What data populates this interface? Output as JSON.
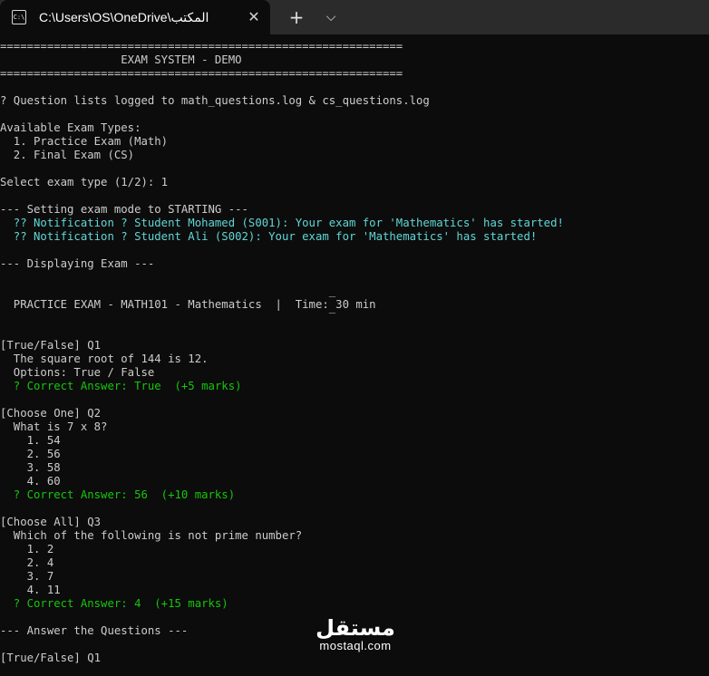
{
  "window": {
    "tab_icon_text": "C:\\",
    "tab_title": "C:\\Users\\OS\\OneDrive\\المكتب",
    "close_glyph": "✕",
    "new_tab_glyph": "+",
    "dropdown_glyph": "⌵"
  },
  "terminal": {
    "lines": [
      {
        "text": "============================================================",
        "color": "default"
      },
      {
        "text": "                  EXAM SYSTEM - DEMO",
        "color": "default"
      },
      {
        "text": "============================================================",
        "color": "default"
      },
      {
        "text": "",
        "color": "default"
      },
      {
        "text": "? Question lists logged to math_questions.log & cs_questions.log",
        "color": "default"
      },
      {
        "text": "",
        "color": "default"
      },
      {
        "text": "Available Exam Types:",
        "color": "default"
      },
      {
        "text": "  1. Practice Exam (Math)",
        "color": "default"
      },
      {
        "text": "  2. Final Exam (CS)",
        "color": "default"
      },
      {
        "text": "",
        "color": "default"
      },
      {
        "text": "Select exam type (1/2): 1",
        "color": "default"
      },
      {
        "text": "",
        "color": "default"
      },
      {
        "text": "--- Setting exam mode to STARTING ---",
        "color": "default"
      },
      {
        "text": "  ?? Notification ? Student Mohamed (S001): Your exam for 'Mathematics' has started!",
        "color": "cyan"
      },
      {
        "text": "  ?? Notification ? Student Ali (S002): Your exam for 'Mathematics' has started!",
        "color": "cyan"
      },
      {
        "text": "",
        "color": "default"
      },
      {
        "text": "--- Displaying Exam ---",
        "color": "default"
      },
      {
        "text": "",
        "color": "default"
      },
      {
        "text": "                                                 _",
        "color": "default"
      },
      {
        "text": "  PRACTICE EXAM - MATH101 - Mathematics  |  Time: 30 min",
        "color": "default"
      },
      {
        "text": "                                                 ‾",
        "color": "default"
      },
      {
        "text": "",
        "color": "default"
      },
      {
        "text": "[True/False] Q1",
        "color": "default"
      },
      {
        "text": "  The square root of 144 is 12.",
        "color": "default"
      },
      {
        "text": "  Options: True / False",
        "color": "default"
      },
      {
        "text": "  ? Correct Answer: True  (+5 marks)",
        "color": "green"
      },
      {
        "text": "",
        "color": "default"
      },
      {
        "text": "[Choose One] Q2",
        "color": "default"
      },
      {
        "text": "  What is 7 x 8?",
        "color": "default"
      },
      {
        "text": "    1. 54",
        "color": "default"
      },
      {
        "text": "    2. 56",
        "color": "default"
      },
      {
        "text": "    3. 58",
        "color": "default"
      },
      {
        "text": "    4. 60",
        "color": "default"
      },
      {
        "text": "  ? Correct Answer: 56  (+10 marks)",
        "color": "green"
      },
      {
        "text": "",
        "color": "default"
      },
      {
        "text": "[Choose All] Q3",
        "color": "default"
      },
      {
        "text": "  Which of the following is not prime number?",
        "color": "default"
      },
      {
        "text": "    1. 2",
        "color": "default"
      },
      {
        "text": "    2. 4",
        "color": "default"
      },
      {
        "text": "    3. 7",
        "color": "default"
      },
      {
        "text": "    4. 11",
        "color": "default"
      },
      {
        "text": "  ? Correct Answer: 4  (+15 marks)",
        "color": "green"
      },
      {
        "text": "",
        "color": "default"
      },
      {
        "text": "--- Answer the Questions ---",
        "color": "default"
      },
      {
        "text": "",
        "color": "default"
      },
      {
        "text": "[True/False] Q1",
        "color": "default"
      }
    ]
  },
  "watermark": {
    "arabic": "مستقل",
    "latin": "mostaql.com"
  },
  "colors": {
    "background": "#0c0c0c",
    "titlebar": "#2b2b2b",
    "default_text": "#cccccc",
    "cyan_text": "#61d6d6",
    "green_text": "#16c60c"
  }
}
